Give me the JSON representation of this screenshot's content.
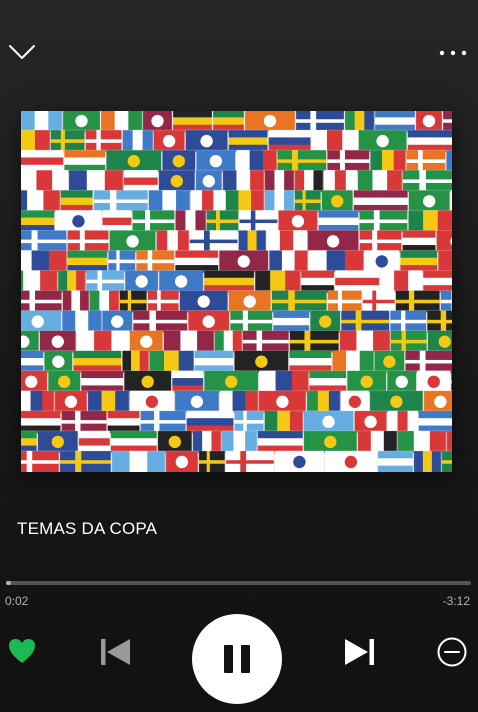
{
  "player": {
    "track_title": "TEMAS DA COPA",
    "elapsed": "0:02",
    "remaining": "-3:12",
    "progress_fraction": 0.01,
    "liked": true
  },
  "icons": {
    "collapse": "chevron-down-icon",
    "more": "more-options-icon",
    "like": "heart-icon",
    "previous": "skip-previous-icon",
    "pause": "pause-icon",
    "next": "skip-next-icon",
    "hide": "remove-circle-icon"
  },
  "colors": {
    "accent": "#1db954",
    "background": "#1c1c1c",
    "text": "#ffffff",
    "secondary_text": "#b3b3b3",
    "progress_track": "#555555"
  }
}
